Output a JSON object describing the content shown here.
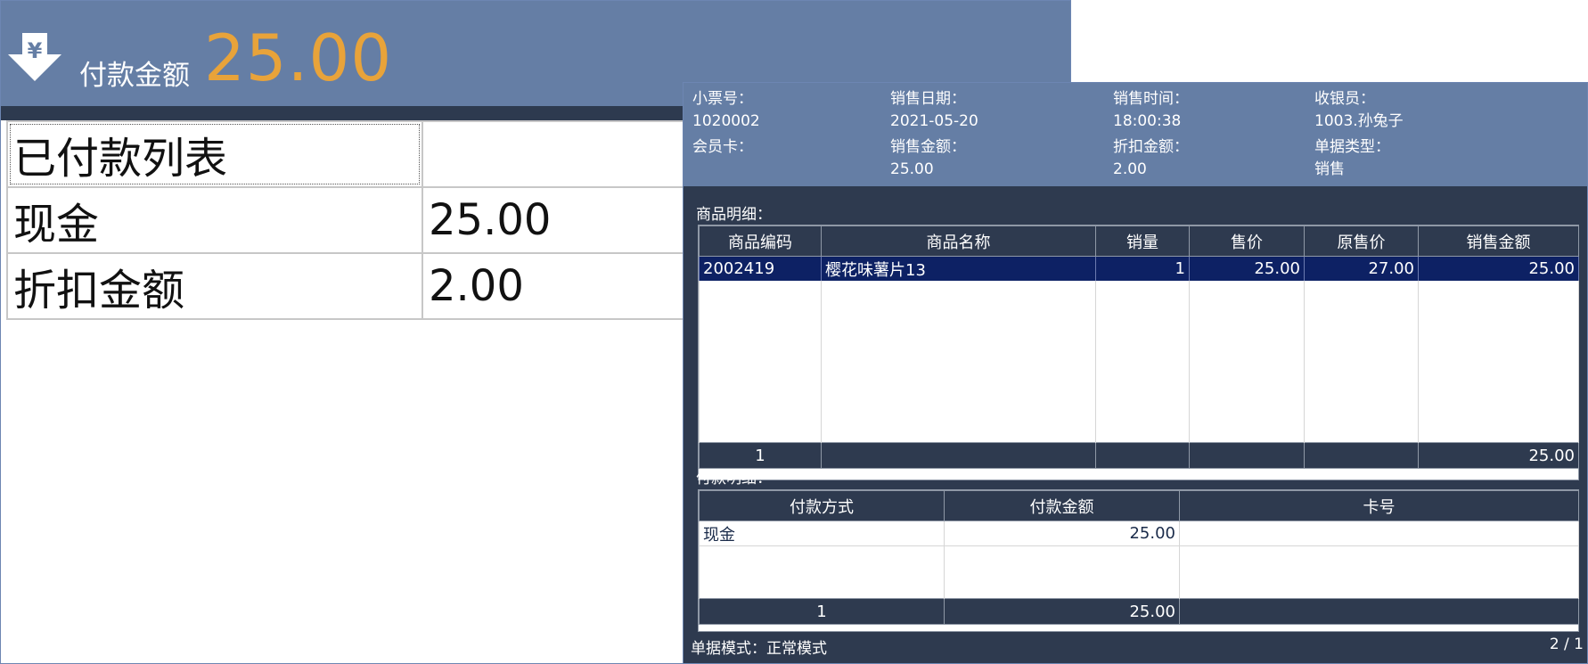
{
  "payment": {
    "label": "付款金额",
    "amount": "25.00",
    "icon": "yen-download-icon",
    "accent_color": "#e8a33a",
    "header_color": "#657ea5"
  },
  "paid_list": {
    "title": "已付款列表",
    "rows": [
      {
        "name": "现金",
        "amount": "25.00"
      },
      {
        "name": "折扣金额",
        "amount": "2.00"
      }
    ]
  },
  "receipt": {
    "info": {
      "ticket_no_label": "小票号：",
      "ticket_no": "1020002",
      "sale_date_label": "销售日期：",
      "sale_date": "2021-05-20",
      "sale_time_label": "销售时间：",
      "sale_time": "18:00:38",
      "cashier_label": "收银员：",
      "cashier": "1003.孙兔子",
      "member_card_label": "会员卡：",
      "sale_amount_label": "销售金额：",
      "sale_amount": "25.00",
      "discount_label": "折扣金额：",
      "discount": "2.00",
      "doc_type_label": "单据类型：",
      "doc_type": "销售"
    },
    "goods": {
      "title": "商品明细：",
      "headers": [
        "商品编码",
        "商品名称",
        "销量",
        "售价",
        "原售价",
        "销售金额"
      ],
      "rows": [
        {
          "code": "2002419",
          "name": "樱花味薯片13",
          "qty": "1",
          "price": "25.00",
          "orig_price": "27.00",
          "amount": "25.00"
        }
      ],
      "total_count": "1",
      "total_amount": "25.00"
    },
    "payments": {
      "title": "付款明细：",
      "headers": [
        "付款方式",
        "付款金额",
        "卡号"
      ],
      "rows": [
        {
          "method": "现金",
          "amount": "25.00",
          "card": ""
        }
      ],
      "total_count": "1",
      "total_amount": "25.00"
    },
    "footer": {
      "mode": "单据模式：正常模式",
      "page": "2 / 1"
    }
  }
}
